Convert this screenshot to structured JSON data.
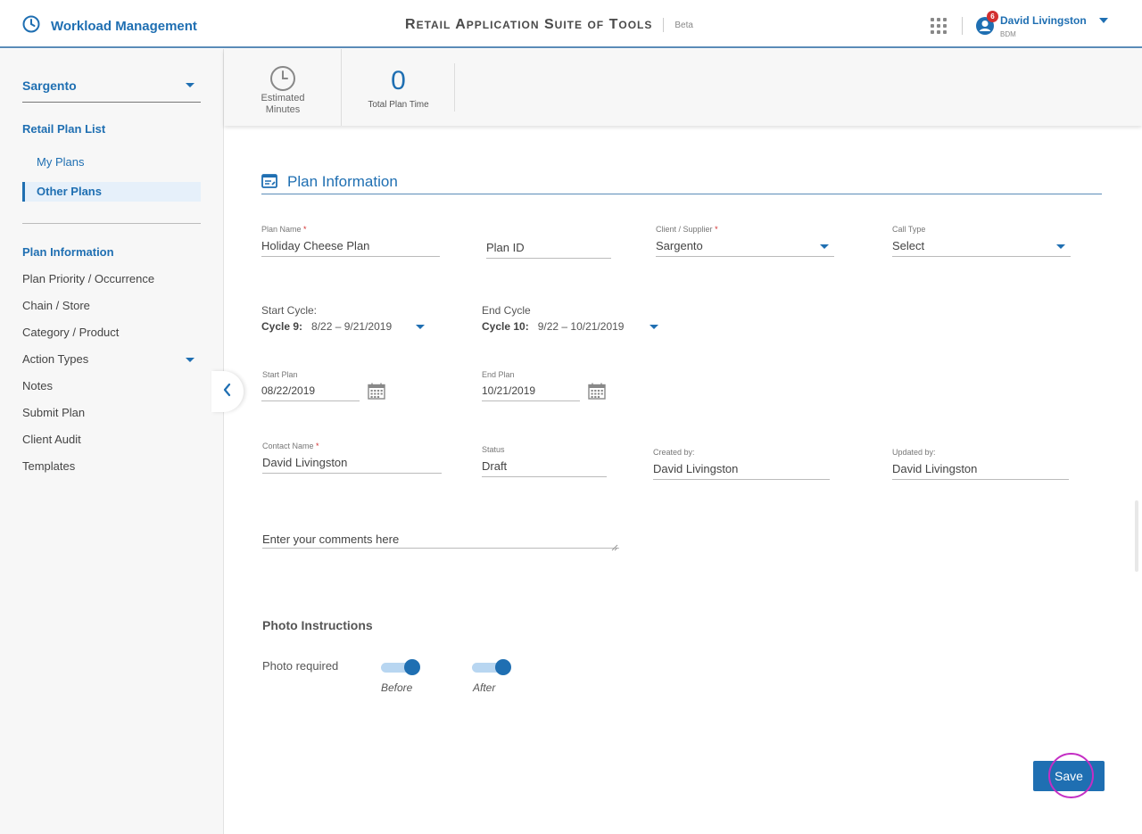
{
  "header": {
    "app_title": "Workload Management",
    "suite": {
      "r": "R",
      "etail": "ETAIL",
      "a": "A",
      "pplication": "PPLICATION",
      "s": "S",
      "uite": "UITE",
      "of": "OF",
      "t": "T",
      "ools": "OOLS"
    },
    "beta": "Beta",
    "user_name": "David Livingston",
    "user_role": "BDM",
    "notifications": "6"
  },
  "sidebar": {
    "client": "Sargento",
    "retail_plan_list": "Retail Plan List",
    "my_plans": "My Plans",
    "other_plans": "Other Plans",
    "nav": [
      "Plan Information",
      "Plan Priority / Occurrence",
      "Chain / Store",
      "Category / Product",
      "Action Types",
      "Notes",
      "Submit Plan",
      "Client Audit",
      "Templates"
    ]
  },
  "summary": {
    "estimated_line1": "Estimated",
    "estimated_line2": "Minutes",
    "total_value": "0",
    "total_label": "Total Plan Time"
  },
  "form": {
    "section_title": "Plan Information",
    "plan_name_label": "Plan Name",
    "plan_name_value": "Holiday Cheese Plan",
    "plan_id_value": "Plan ID",
    "client_label": "Client / Supplier",
    "client_value": "Sargento",
    "call_type_label": "Call Type",
    "call_type_value": "Select",
    "start_cycle_title": "Start Cycle:",
    "start_cycle_name": "Cycle 9:",
    "start_cycle_range": "8/22 – 9/21/2019",
    "end_cycle_title": "End Cycle",
    "end_cycle_name": "Cycle 10:",
    "end_cycle_range": "9/22 – 10/21/2019",
    "start_plan_label": "Start Plan",
    "start_plan_value": "08/22/2019",
    "end_plan_label": "End Plan",
    "end_plan_value": "10/21/2019",
    "contact_label": "Contact Name",
    "contact_value": "David Livingston",
    "status_label": "Status",
    "status_value": "Draft",
    "created_label": "Created by:",
    "created_value": "David Livingston",
    "updated_label": "Updated by:",
    "updated_value": "David Livingston",
    "comments_placeholder": "Enter your comments here",
    "required_mark": "*"
  },
  "photo": {
    "title": "Photo Instructions",
    "required_label": "Photo required",
    "before_label": "Before",
    "after_label": "After",
    "before_on": true,
    "after_on": true
  },
  "actions": {
    "save": "Save"
  },
  "colors": {
    "accent": "#1f6fb2",
    "required": "#d32f2f",
    "highlight_ring": "#c42ec4"
  }
}
